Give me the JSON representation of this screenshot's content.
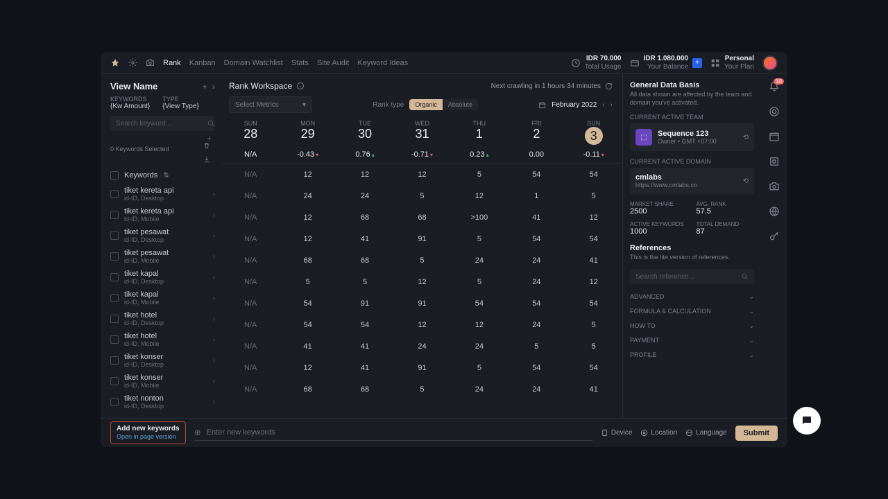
{
  "topbar": {
    "nav": [
      "Rank",
      "Kanban",
      "Domain Watchlist",
      "Stats",
      "Site Audit",
      "Keyword Ideas"
    ],
    "active_nav": "Rank",
    "usage": {
      "amount": "IDR 70.000",
      "label": "Total Usage"
    },
    "balance": {
      "amount": "IDR 1.080.000",
      "label": "Your Balance"
    },
    "plan": {
      "name": "Personal",
      "label": "Your Plan"
    }
  },
  "left": {
    "title": "View Name",
    "keywords_label": "KEYWORDS",
    "keywords_value": "{Kw Amount}",
    "type_label": "TYPE",
    "type_value": "{View Type}",
    "search_placeholder": "Search keyword...",
    "selected_text": "0 Keywords Selected",
    "header": "Keywords",
    "items": [
      {
        "name": "tiket kereta api",
        "meta": "id-ID, Desktop"
      },
      {
        "name": "tiket kereta api",
        "meta": "id-ID, Mobile"
      },
      {
        "name": "tiket pesawat",
        "meta": "id-ID, Desktop"
      },
      {
        "name": "tiket pesawat",
        "meta": "id-ID, Mobile"
      },
      {
        "name": "tiket kapal",
        "meta": "id-ID, Desktop"
      },
      {
        "name": "tiket kapal",
        "meta": "id-ID, Mobile"
      },
      {
        "name": "tiket hotel",
        "meta": "id-ID, Desktop"
      },
      {
        "name": "tiket hotel",
        "meta": "id-ID, Mobile"
      },
      {
        "name": "tiket konser",
        "meta": "id-ID, Desktop"
      },
      {
        "name": "tiket konser",
        "meta": "id-ID, Mobile"
      },
      {
        "name": "tiket nonton",
        "meta": "id-ID, Desktop"
      }
    ]
  },
  "center": {
    "title": "Rank Workspace",
    "crawl": "Next crawling in 1 hours 34 minutes",
    "metrics_placeholder": "Select Metrics",
    "rank_type_label": "Rank type",
    "pill_organic": "Organic",
    "pill_absolute": "Absolute",
    "date": "February 2022",
    "days": [
      {
        "dow": "SUN",
        "num": "28"
      },
      {
        "dow": "MON",
        "num": "29"
      },
      {
        "dow": "TUE",
        "num": "30"
      },
      {
        "dow": "WED",
        "num": "31"
      },
      {
        "dow": "THU",
        "num": "1"
      },
      {
        "dow": "FRI",
        "num": "2"
      },
      {
        "dow": "SUN",
        "num": "3",
        "today": true
      }
    ],
    "deltas": [
      {
        "v": "N/A"
      },
      {
        "v": "-0.43",
        "dir": "down"
      },
      {
        "v": "0.76",
        "dir": "up"
      },
      {
        "v": "-0.71",
        "dir": "down"
      },
      {
        "v": "0.23",
        "dir": "up"
      },
      {
        "v": "0.00"
      },
      {
        "v": "-0.11",
        "dir": "down"
      }
    ],
    "rows": [
      [
        "N/A",
        "12",
        "12",
        "12",
        "5",
        "54",
        "54"
      ],
      [
        "N/A",
        "24",
        "24",
        "5",
        "12",
        "1",
        "5"
      ],
      [
        "N/A",
        "12",
        "68",
        "68",
        ">100",
        "41",
        "12"
      ],
      [
        "N/A",
        "12",
        "41",
        "91",
        "5",
        "54",
        "54"
      ],
      [
        "N/A",
        "68",
        "68",
        "5",
        "24",
        "24",
        "41"
      ],
      [
        "N/A",
        "5",
        "5",
        "12",
        "5",
        "24",
        "12"
      ],
      [
        "N/A",
        "54",
        "91",
        "91",
        "54",
        "54",
        "54"
      ],
      [
        "N/A",
        "54",
        "54",
        "12",
        "12",
        "24",
        "5"
      ],
      [
        "N/A",
        "41",
        "41",
        "24",
        "24",
        "5",
        "5"
      ],
      [
        "N/A",
        "12",
        "41",
        "91",
        "5",
        "54",
        "54"
      ],
      [
        "N/A",
        "68",
        "68",
        "5",
        "24",
        "24",
        "41"
      ]
    ]
  },
  "bottom": {
    "add_title": "Add new keywords",
    "add_sub": "Open in page version",
    "enter_placeholder": "Enter new keywords",
    "device": "Device",
    "location": "Location",
    "language": "Language",
    "submit": "Submit"
  },
  "right": {
    "title": "General Data Basis",
    "desc": "All data shown are affected by the team and domain you've activated.",
    "team_label": "CURRENT ACTIVE TEAM",
    "team_name": "Sequence 123",
    "team_sub": "Owner • GMT +07:00",
    "domain_label": "CURRENT ACTIVE DOMAIN",
    "domain_name": "cmlabs",
    "domain_url": "https://www.cmlabs.co",
    "stats": [
      {
        "l": "MARKET SHARE",
        "v": "2500"
      },
      {
        "l": "AVG. RANK",
        "v": "57.5"
      },
      {
        "l": "ACTIVE KEYWORDS",
        "v": "1000"
      },
      {
        "l": "TOTAL DEMAND",
        "v": "87"
      }
    ],
    "ref_title": "References",
    "ref_desc": "This is the lite version of references.",
    "ref_search": "Search reference...",
    "accordions": [
      "ADVANCED",
      "FORMULA & CALCULATION",
      "HOW TO",
      "PAYMENT",
      "PROFILE"
    ]
  },
  "rail": {
    "badge": "10"
  }
}
